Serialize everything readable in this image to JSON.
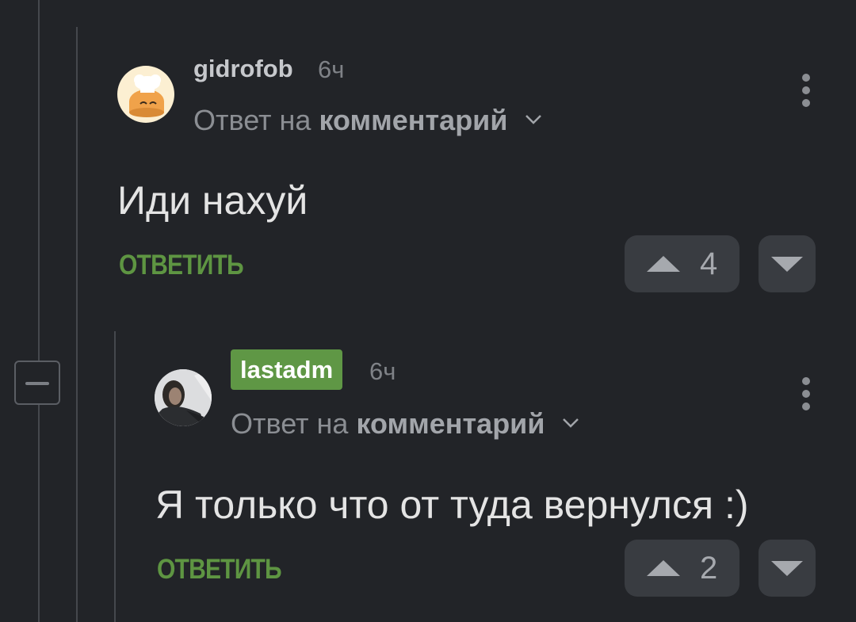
{
  "comments": [
    {
      "username": "gidrofob",
      "time": "6ч",
      "reply_prefix": "Ответ на",
      "reply_target": "комментарий",
      "body": "Иди нахуй",
      "reply_label": "ОТВЕТИТЬ",
      "score": "4"
    },
    {
      "username": "lastadm",
      "time": "6ч",
      "reply_prefix": "Ответ на",
      "reply_target": "комментарий",
      "body": "Я только что от туда вернулся :)",
      "reply_label": "ОТВЕТИТЬ",
      "score": "2"
    }
  ],
  "icons": {
    "collapse": "minus-icon",
    "menu": "kebab-menu-icon",
    "upvote": "triangle-up-icon",
    "downvote": "triangle-down-icon",
    "expand": "chevron-down-icon"
  },
  "colors": {
    "background": "#222428",
    "accent_green": "#5f9745",
    "vote_button": "#393c41"
  }
}
